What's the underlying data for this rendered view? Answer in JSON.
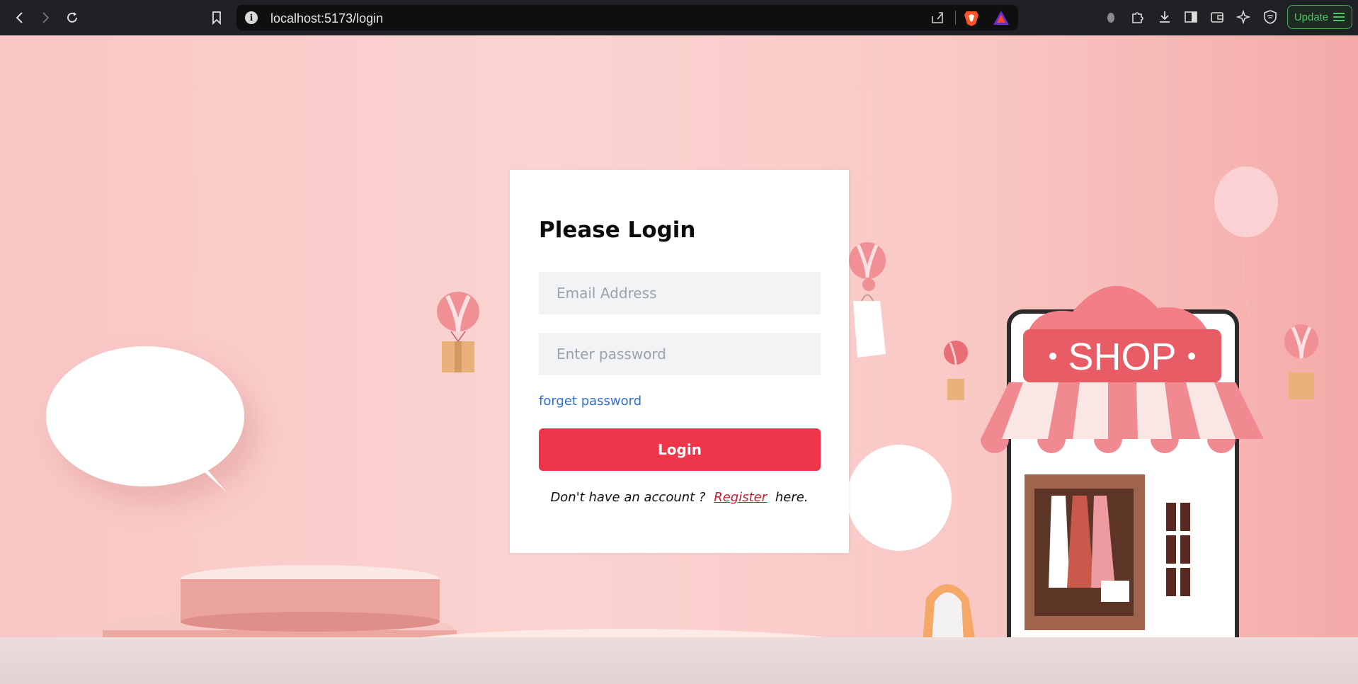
{
  "browser": {
    "url": "localhost:5173/login",
    "update_label": "Update"
  },
  "login": {
    "title": "Please Login",
    "email_placeholder": "Email Address",
    "password_placeholder": "Enter password",
    "forget_link": "forget password",
    "login_button": "Login",
    "register_prefix": "Don't have an account ?",
    "register_link": "Register",
    "register_suffix": "here."
  },
  "scene": {
    "shop_sign": "SHOP"
  },
  "colors": {
    "accent": "#ee3549",
    "link": "#2f6fd6",
    "register_link": "#c4202e",
    "update_green": "#49c463"
  }
}
